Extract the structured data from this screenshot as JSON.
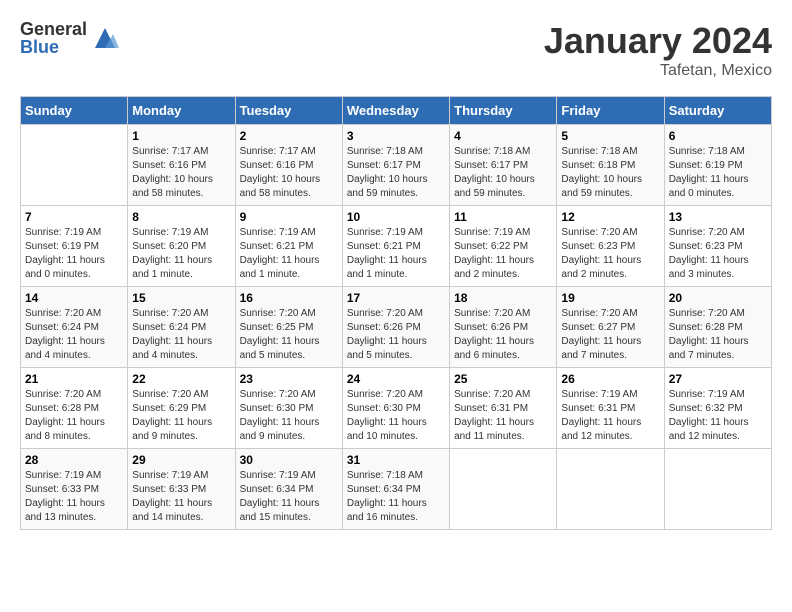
{
  "header": {
    "logo": {
      "general": "General",
      "blue": "Blue"
    },
    "title": "January 2024",
    "location": "Tafetan, Mexico"
  },
  "days_of_week": [
    "Sunday",
    "Monday",
    "Tuesday",
    "Wednesday",
    "Thursday",
    "Friday",
    "Saturday"
  ],
  "weeks": [
    [
      {
        "day": "",
        "sunrise": "",
        "sunset": "",
        "daylight": ""
      },
      {
        "day": "1",
        "sunrise": "Sunrise: 7:17 AM",
        "sunset": "Sunset: 6:16 PM",
        "daylight": "Daylight: 10 hours and 58 minutes."
      },
      {
        "day": "2",
        "sunrise": "Sunrise: 7:17 AM",
        "sunset": "Sunset: 6:16 PM",
        "daylight": "Daylight: 10 hours and 58 minutes."
      },
      {
        "day": "3",
        "sunrise": "Sunrise: 7:18 AM",
        "sunset": "Sunset: 6:17 PM",
        "daylight": "Daylight: 10 hours and 59 minutes."
      },
      {
        "day": "4",
        "sunrise": "Sunrise: 7:18 AM",
        "sunset": "Sunset: 6:17 PM",
        "daylight": "Daylight: 10 hours and 59 minutes."
      },
      {
        "day": "5",
        "sunrise": "Sunrise: 7:18 AM",
        "sunset": "Sunset: 6:18 PM",
        "daylight": "Daylight: 10 hours and 59 minutes."
      },
      {
        "day": "6",
        "sunrise": "Sunrise: 7:18 AM",
        "sunset": "Sunset: 6:19 PM",
        "daylight": "Daylight: 11 hours and 0 minutes."
      }
    ],
    [
      {
        "day": "7",
        "sunrise": "Sunrise: 7:19 AM",
        "sunset": "Sunset: 6:19 PM",
        "daylight": "Daylight: 11 hours and 0 minutes."
      },
      {
        "day": "8",
        "sunrise": "Sunrise: 7:19 AM",
        "sunset": "Sunset: 6:20 PM",
        "daylight": "Daylight: 11 hours and 1 minute."
      },
      {
        "day": "9",
        "sunrise": "Sunrise: 7:19 AM",
        "sunset": "Sunset: 6:21 PM",
        "daylight": "Daylight: 11 hours and 1 minute."
      },
      {
        "day": "10",
        "sunrise": "Sunrise: 7:19 AM",
        "sunset": "Sunset: 6:21 PM",
        "daylight": "Daylight: 11 hours and 1 minute."
      },
      {
        "day": "11",
        "sunrise": "Sunrise: 7:19 AM",
        "sunset": "Sunset: 6:22 PM",
        "daylight": "Daylight: 11 hours and 2 minutes."
      },
      {
        "day": "12",
        "sunrise": "Sunrise: 7:20 AM",
        "sunset": "Sunset: 6:23 PM",
        "daylight": "Daylight: 11 hours and 2 minutes."
      },
      {
        "day": "13",
        "sunrise": "Sunrise: 7:20 AM",
        "sunset": "Sunset: 6:23 PM",
        "daylight": "Daylight: 11 hours and 3 minutes."
      }
    ],
    [
      {
        "day": "14",
        "sunrise": "Sunrise: 7:20 AM",
        "sunset": "Sunset: 6:24 PM",
        "daylight": "Daylight: 11 hours and 4 minutes."
      },
      {
        "day": "15",
        "sunrise": "Sunrise: 7:20 AM",
        "sunset": "Sunset: 6:24 PM",
        "daylight": "Daylight: 11 hours and 4 minutes."
      },
      {
        "day": "16",
        "sunrise": "Sunrise: 7:20 AM",
        "sunset": "Sunset: 6:25 PM",
        "daylight": "Daylight: 11 hours and 5 minutes."
      },
      {
        "day": "17",
        "sunrise": "Sunrise: 7:20 AM",
        "sunset": "Sunset: 6:26 PM",
        "daylight": "Daylight: 11 hours and 5 minutes."
      },
      {
        "day": "18",
        "sunrise": "Sunrise: 7:20 AM",
        "sunset": "Sunset: 6:26 PM",
        "daylight": "Daylight: 11 hours and 6 minutes."
      },
      {
        "day": "19",
        "sunrise": "Sunrise: 7:20 AM",
        "sunset": "Sunset: 6:27 PM",
        "daylight": "Daylight: 11 hours and 7 minutes."
      },
      {
        "day": "20",
        "sunrise": "Sunrise: 7:20 AM",
        "sunset": "Sunset: 6:28 PM",
        "daylight": "Daylight: 11 hours and 7 minutes."
      }
    ],
    [
      {
        "day": "21",
        "sunrise": "Sunrise: 7:20 AM",
        "sunset": "Sunset: 6:28 PM",
        "daylight": "Daylight: 11 hours and 8 minutes."
      },
      {
        "day": "22",
        "sunrise": "Sunrise: 7:20 AM",
        "sunset": "Sunset: 6:29 PM",
        "daylight": "Daylight: 11 hours and 9 minutes."
      },
      {
        "day": "23",
        "sunrise": "Sunrise: 7:20 AM",
        "sunset": "Sunset: 6:30 PM",
        "daylight": "Daylight: 11 hours and 9 minutes."
      },
      {
        "day": "24",
        "sunrise": "Sunrise: 7:20 AM",
        "sunset": "Sunset: 6:30 PM",
        "daylight": "Daylight: 11 hours and 10 minutes."
      },
      {
        "day": "25",
        "sunrise": "Sunrise: 7:20 AM",
        "sunset": "Sunset: 6:31 PM",
        "daylight": "Daylight: 11 hours and 11 minutes."
      },
      {
        "day": "26",
        "sunrise": "Sunrise: 7:19 AM",
        "sunset": "Sunset: 6:31 PM",
        "daylight": "Daylight: 11 hours and 12 minutes."
      },
      {
        "day": "27",
        "sunrise": "Sunrise: 7:19 AM",
        "sunset": "Sunset: 6:32 PM",
        "daylight": "Daylight: 11 hours and 12 minutes."
      }
    ],
    [
      {
        "day": "28",
        "sunrise": "Sunrise: 7:19 AM",
        "sunset": "Sunset: 6:33 PM",
        "daylight": "Daylight: 11 hours and 13 minutes."
      },
      {
        "day": "29",
        "sunrise": "Sunrise: 7:19 AM",
        "sunset": "Sunset: 6:33 PM",
        "daylight": "Daylight: 11 hours and 14 minutes."
      },
      {
        "day": "30",
        "sunrise": "Sunrise: 7:19 AM",
        "sunset": "Sunset: 6:34 PM",
        "daylight": "Daylight: 11 hours and 15 minutes."
      },
      {
        "day": "31",
        "sunrise": "Sunrise: 7:18 AM",
        "sunset": "Sunset: 6:34 PM",
        "daylight": "Daylight: 11 hours and 16 minutes."
      },
      {
        "day": "",
        "sunrise": "",
        "sunset": "",
        "daylight": ""
      },
      {
        "day": "",
        "sunrise": "",
        "sunset": "",
        "daylight": ""
      },
      {
        "day": "",
        "sunrise": "",
        "sunset": "",
        "daylight": ""
      }
    ]
  ]
}
